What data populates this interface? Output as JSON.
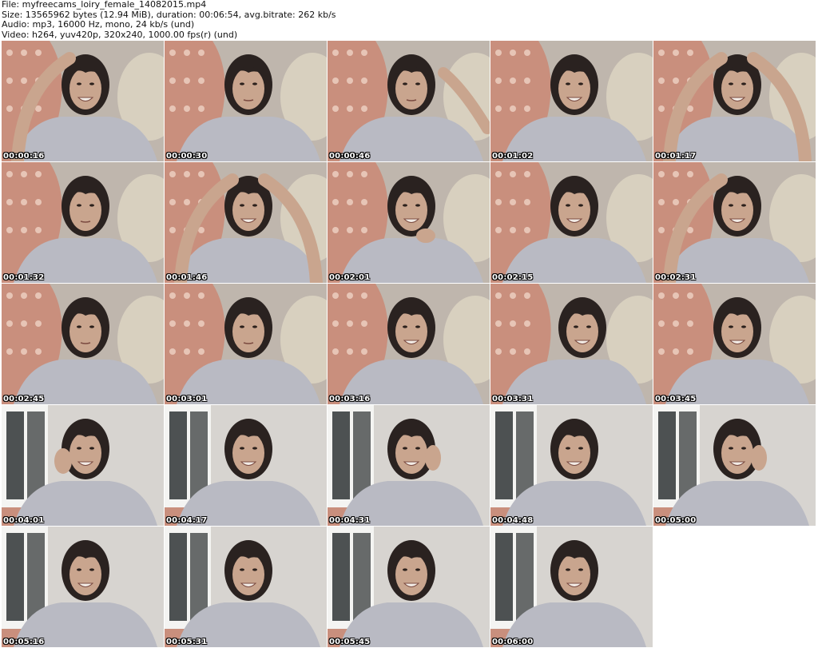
{
  "header": {
    "file_line": "File: myfreecams_loiry_female_14082015.mp4",
    "size_line": "Size: 13565962 bytes (12.94 MiB), duration: 00:06:54, avg.bitrate: 262 kb/s",
    "audio_line": "Audio: mp3, 16000 Hz, mono, 24 kb/s (und)",
    "video_line": "Video: h264, yuv420p, 320x240, 1000.00 fps(r) (und)"
  },
  "thumbnails": [
    {
      "timestamp": "00:00:16",
      "scene": "pillow",
      "pose": "arm-up-left"
    },
    {
      "timestamp": "00:00:30",
      "scene": "pillow",
      "pose": "neutral"
    },
    {
      "timestamp": "00:00:46",
      "scene": "pillow",
      "pose": "arm-right"
    },
    {
      "timestamp": "00:01:02",
      "scene": "pillow",
      "pose": "smile"
    },
    {
      "timestamp": "00:01:17",
      "scene": "pillow",
      "pose": "arms-up"
    },
    {
      "timestamp": "00:01:32",
      "scene": "pillow",
      "pose": "neutral"
    },
    {
      "timestamp": "00:01:46",
      "scene": "pillow",
      "pose": "arms-up"
    },
    {
      "timestamp": "00:02:01",
      "scene": "pillow",
      "pose": "hand-chin"
    },
    {
      "timestamp": "00:02:15",
      "scene": "pillow",
      "pose": "smile"
    },
    {
      "timestamp": "00:02:31",
      "scene": "pillow",
      "pose": "arm-up-left"
    },
    {
      "timestamp": "00:02:45",
      "scene": "pillow",
      "pose": "neutral"
    },
    {
      "timestamp": "00:03:01",
      "scene": "pillow",
      "pose": "neutral"
    },
    {
      "timestamp": "00:03:16",
      "scene": "pillow",
      "pose": "smile"
    },
    {
      "timestamp": "00:03:31",
      "scene": "pillow",
      "pose": "tilt"
    },
    {
      "timestamp": "00:03:45",
      "scene": "pillow",
      "pose": "smile"
    },
    {
      "timestamp": "00:04:01",
      "scene": "window",
      "pose": "hand-hair"
    },
    {
      "timestamp": "00:04:17",
      "scene": "window",
      "pose": "smile"
    },
    {
      "timestamp": "00:04:31",
      "scene": "window",
      "pose": "hand-cheek"
    },
    {
      "timestamp": "00:04:48",
      "scene": "window",
      "pose": "smile"
    },
    {
      "timestamp": "00:05:00",
      "scene": "window",
      "pose": "hand-cheek"
    },
    {
      "timestamp": "00:05:16",
      "scene": "window",
      "pose": "smile"
    },
    {
      "timestamp": "00:05:31",
      "scene": "window",
      "pose": "smile"
    },
    {
      "timestamp": "00:05:45",
      "scene": "window",
      "pose": "smile"
    },
    {
      "timestamp": "00:06:00",
      "scene": "window",
      "pose": "smile"
    }
  ],
  "colors": {
    "background": "#ffffff",
    "timestamp_text": "#ffffff",
    "pillow": "#c98f7d",
    "pillow_pattern": "#efd2c4",
    "wall_warm": "#bfb6ad",
    "wall_cool": "#d7d4d0",
    "window_frame": "#f4f4f2",
    "window_glass": "#4d5152",
    "shirt": "#b9bac3",
    "skin": "#c9a58e",
    "hair": "#2a2220"
  }
}
